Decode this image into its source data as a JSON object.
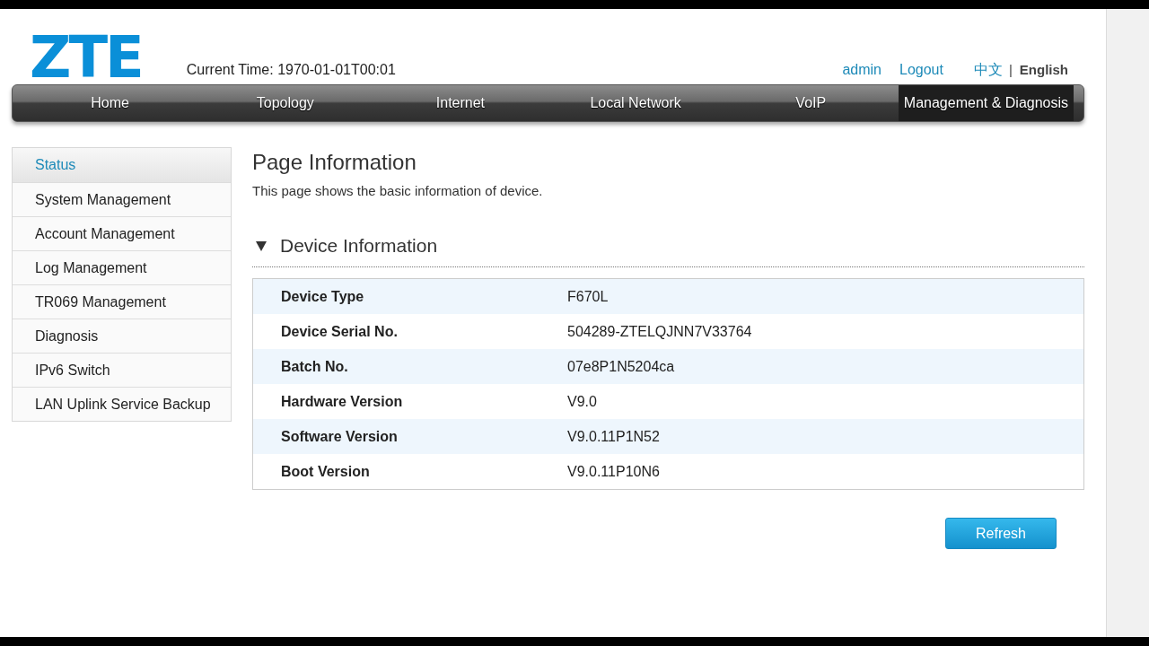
{
  "header": {
    "logo": "ZTE",
    "current_time": "Current Time: 1970-01-01T00:01",
    "user": "admin",
    "logout": "Logout",
    "languages": [
      {
        "label": "中文",
        "selected": false
      },
      {
        "label": "English",
        "selected": true
      }
    ],
    "language_separator": "|"
  },
  "nav_tabs": [
    {
      "label": "Home",
      "selected": false
    },
    {
      "label": "Topology",
      "selected": false
    },
    {
      "label": "Internet",
      "selected": false
    },
    {
      "label": "Local Network",
      "selected": false
    },
    {
      "label": "VoIP",
      "selected": false
    },
    {
      "label": "Management & Diagnosis",
      "selected": true
    }
  ],
  "sidebar": {
    "items": [
      {
        "label": "Status",
        "selected": true
      },
      {
        "label": "System Management",
        "selected": false
      },
      {
        "label": "Account Management",
        "selected": false
      },
      {
        "label": "Log Management",
        "selected": false
      },
      {
        "label": "TR069 Management",
        "selected": false
      },
      {
        "label": "Diagnosis",
        "selected": false
      },
      {
        "label": "IPv6 Switch",
        "selected": false
      },
      {
        "label": "LAN Uplink Service Backup",
        "selected": false
      }
    ]
  },
  "page": {
    "title": "Page Information",
    "description": "This page shows the basic information of device.",
    "section": {
      "title": "Device Information",
      "expanded": true,
      "rows": [
        {
          "label": "Device Type",
          "value": "F670L"
        },
        {
          "label": "Device Serial No.",
          "value": "504289-ZTELQJNN7V33764"
        },
        {
          "label": "Batch No.",
          "value": "07e8P1N5204ca"
        },
        {
          "label": "Hardware Version",
          "value": "V9.0"
        },
        {
          "label": "Software Version",
          "value": "V9.0.11P1N52"
        },
        {
          "label": "Boot Version",
          "value": "V9.0.11P10N6"
        }
      ]
    }
  },
  "buttons": [
    {
      "label": "Refresh"
    }
  ]
}
